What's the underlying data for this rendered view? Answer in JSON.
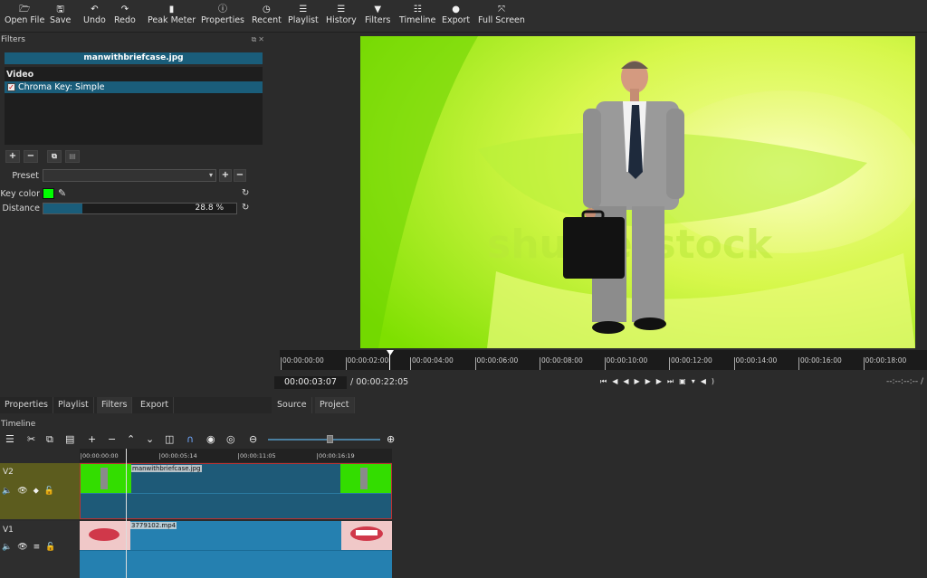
{
  "toolbar": [
    {
      "name": "open-file-button",
      "icon": "folder-icon",
      "glyph": "🗁",
      "label": "Open File"
    },
    {
      "name": "save-button",
      "icon": "save-icon",
      "glyph": "🖫",
      "label": "Save"
    },
    {
      "name": "undo-button",
      "icon": "undo-icon",
      "glyph": "↶",
      "label": "Undo"
    },
    {
      "name": "redo-button",
      "icon": "redo-icon",
      "glyph": "↷",
      "label": "Redo"
    },
    {
      "name": "peak-meter-button",
      "icon": "meter-icon",
      "glyph": "▮",
      "label": "Peak Meter"
    },
    {
      "name": "properties-button",
      "icon": "info-icon",
      "glyph": "ⓘ",
      "label": "Properties"
    },
    {
      "name": "recent-button",
      "icon": "clock-icon",
      "glyph": "◷",
      "label": "Recent"
    },
    {
      "name": "playlist-button",
      "icon": "list-icon",
      "glyph": "☰",
      "label": "Playlist"
    },
    {
      "name": "history-button",
      "icon": "history-icon",
      "glyph": "☰",
      "label": "History"
    },
    {
      "name": "filters-button",
      "icon": "funnel-icon",
      "glyph": "▼",
      "label": "Filters"
    },
    {
      "name": "timeline-button",
      "icon": "timeline-icon",
      "glyph": "☷",
      "label": "Timeline"
    },
    {
      "name": "export-button",
      "icon": "export-icon",
      "glyph": "●",
      "label": "Export"
    },
    {
      "name": "full-screen-button",
      "icon": "fullscreen-icon",
      "glyph": "⤧",
      "label": "Full Screen"
    }
  ],
  "filters_panel": {
    "title": "Filters",
    "file": "manwithbriefcase.jpg",
    "list_header": "Video",
    "filters": [
      {
        "label": "Chroma Key: Simple",
        "checked": true
      }
    ],
    "preset_label": "Preset",
    "preset_value": "",
    "key_color_label": "Key color",
    "key_color": "#00ff00",
    "distance_label": "Distance",
    "distance_value": "28.8 %",
    "distance_fraction": 0.2
  },
  "left_tabs": [
    "Properties",
    "Playlist",
    "Filters",
    "Export"
  ],
  "player": {
    "ruler_ticks": [
      "00:00:00:00",
      "00:00:02:00",
      "00:00:04:00",
      "00:00:06:00",
      "00:00:08:00",
      "00:00:10:00",
      "00:00:12:00",
      "00:00:14:00",
      "00:00:16:00",
      "00:00:18:00"
    ],
    "timecode": "00:00:03:07",
    "total": "/ 00:00:22:05",
    "right_timecode": "--:--:--:-- /",
    "watermark": "shutterstock",
    "tabs": [
      "Source",
      "Project"
    ]
  },
  "timeline": {
    "title": "Timeline",
    "ruler_ticks": [
      "00:00:00:00",
      "00:00:05:14",
      "00:00:11:05",
      "00:00:16:19"
    ],
    "tracks": [
      {
        "name": "V2",
        "clip": "manwithbriefcase.jpg"
      },
      {
        "name": "V1",
        "clip": "3779102.mp4"
      }
    ]
  }
}
